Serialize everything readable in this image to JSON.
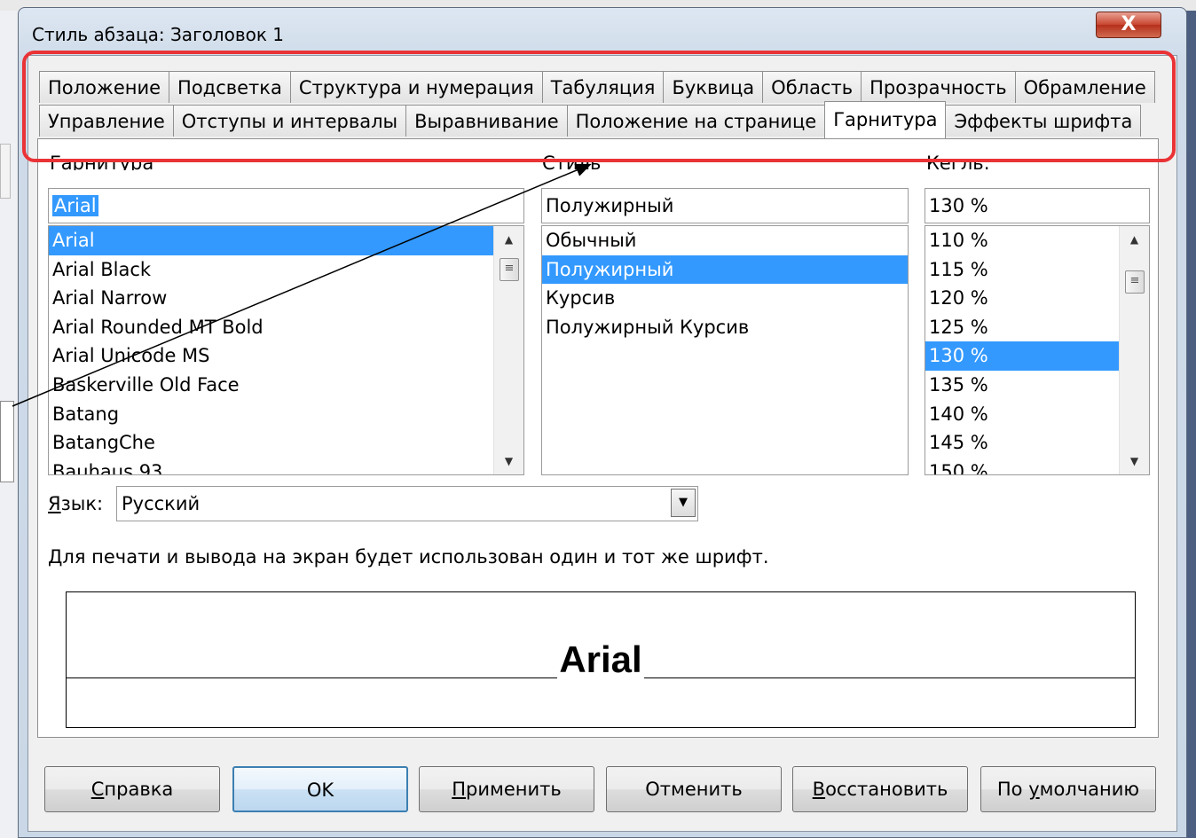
{
  "window": {
    "title": "Стиль абзаца: Заголовок 1",
    "close_label": "X"
  },
  "tabs": {
    "row1": [
      "Положение",
      "Подсветка",
      "Структура и нумерация",
      "Табуляция",
      "Буквица",
      "Область",
      "Прозрачность",
      "Обрамление"
    ],
    "row2": [
      "Управление",
      "Отступы и интервалы",
      "Выравнивание",
      "Положение на странице",
      "Гарнитура",
      "Эффекты шрифта"
    ],
    "active": "Гарнитура"
  },
  "font": {
    "family_label": "Гарнитура",
    "family_value": "Arial",
    "families": [
      "Arial",
      "Arial Black",
      "Arial Narrow",
      "Arial Rounded MT Bold",
      "Arial Unicode MS",
      "Baskerville Old Face",
      "Batang",
      "BatangChe",
      "Bauhaus 93"
    ],
    "style_label": "Стиль",
    "style_value": "Полужирный",
    "styles": [
      "Обычный",
      "Полужирный",
      "Курсив",
      "Полужирный Курсив"
    ],
    "size_label": "Кегль:",
    "size_value": "130 %",
    "sizes": [
      "110 %",
      "115 %",
      "120 %",
      "125 %",
      "130 %",
      "135 %",
      "140 %",
      "145 %",
      "150 %"
    ]
  },
  "language": {
    "label_prefix": "Я",
    "label_rest": "зык:",
    "value": "Русский"
  },
  "info_text": "Для печати и вывода на экран будет использован один и тот же шрифт.",
  "preview_text": "Arial",
  "buttons": {
    "help_u": "С",
    "help_rest": "правка",
    "ok": "OK",
    "apply_u": "П",
    "apply_rest": "рименить",
    "cancel": "Отменить",
    "reset_u": "В",
    "reset_rest": "осстановить",
    "default_pre": "По ",
    "default_u": "у",
    "default_rest": "молчанию"
  },
  "colors": {
    "selection": "#3399ff",
    "highlight_outline": "#ea3336",
    "close_button": "#c8452f"
  }
}
